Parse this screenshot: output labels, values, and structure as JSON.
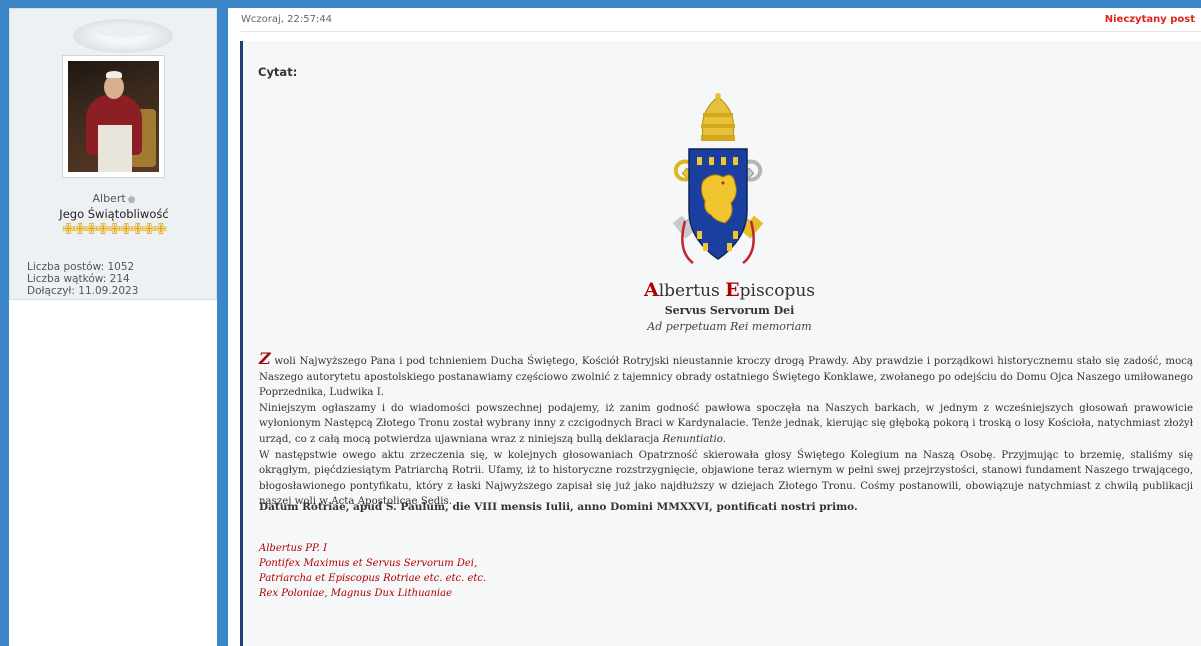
{
  "sidebar": {
    "username": "Albert",
    "online_dot": "●",
    "rank": "Jego Świątobliwość",
    "rank_icons": "✙✙✙✙✙✙✙✙✙",
    "stats": [
      "Liczba postów: 1052",
      "Liczba wątków: 214",
      "Dołączył: 11.09.2023"
    ]
  },
  "post": {
    "date": "Wczoraj, 22:57:44",
    "unread_label": "Nieczytany post",
    "quote_label": "Cytat:",
    "title_initial_1": "A",
    "title_rest_1": "lbertus ",
    "title_initial_2": "E",
    "title_rest_2": "piscopus",
    "subtitle": "Servus Servorum Dei",
    "subtitle2": "Ad perpetuam Rei memoriam",
    "dropcap": "Z",
    "p1": " woli Najwyższego Pana i pod tchnieniem Ducha Świętego, Kościół Rotryjski nieustannie kroczy drogą Prawdy. Aby prawdzie i porządkowi historycznemu stało się zadość, mocą Naszego autorytetu apostolskiego postanawiamy częściowo zwolnić z tajemnicy obrady ostatniego Świętego Konklawe, zwołanego po odejściu do Domu Ojca Naszego umiłowanego Poprzednika, Ludwika I.",
    "p2_a": "Niniejszym ogłaszamy i do wiadomości powszechnej podajemy, iż zanim godność pawłowa spoczęła na Naszych barkach, w jednym z wcześniejszych głosowań prawowicie wyłonionym Następcą Złotego Tronu został wybrany inny z czcigodnych Braci w Kardynalacie. Tenże jednak, kierując się głęboką pokorą i troską o losy Kościoła, natychmiast złożył urząd, co z całą mocą potwierdza ujawniana wraz z niniejszą bullą deklaracja ",
    "p2_italic": "Renuntiatio",
    "p2_b": ".",
    "p3": "W następstwie owego aktu zrzeczenia się, w kolejnych głosowaniach Opatrzność skierowała głosy Świętego Kolegium na Naszą Osobę. Przyjmując to brzemię, staliśmy się okrągłym, pięćdziesiątym Patriarchą Rotrii. Ufamy, iż to historyczne rozstrzygnięcie, objawione teraz wiernym w pełni swej przejrzystości, stanowi fundament Naszego trwającego, błogosławionego pontyfikatu, który z łaski Najwyższego zapisał się już jako najdłuższy w dziejach Złotego Tronu. Cośmy postanowili, obowiązuje natychmiast z chwilą publikacji naszej woli w Acta Apostolicae Sedis.",
    "datum": "Datum Rotriae, apud S. Paulum, die VIII mensis Iulii, anno Domini MMXXVI, pontificati nostri primo.",
    "signature": [
      "Albertus PP. I",
      "Pontifex Maximus et Servus Servorum Dei,",
      "Patriarcha et Episcopus Rotriae etc. etc. etc.",
      "Rex Poloniae, Magnus Dux Lithuaniae"
    ]
  },
  "colors": {
    "accent_blue": "#3a86c8",
    "quote_border": "#1f3f7a",
    "unread_red": "#e0221c",
    "signature_red": "#b00000",
    "rank_gold": "#e4a600"
  }
}
